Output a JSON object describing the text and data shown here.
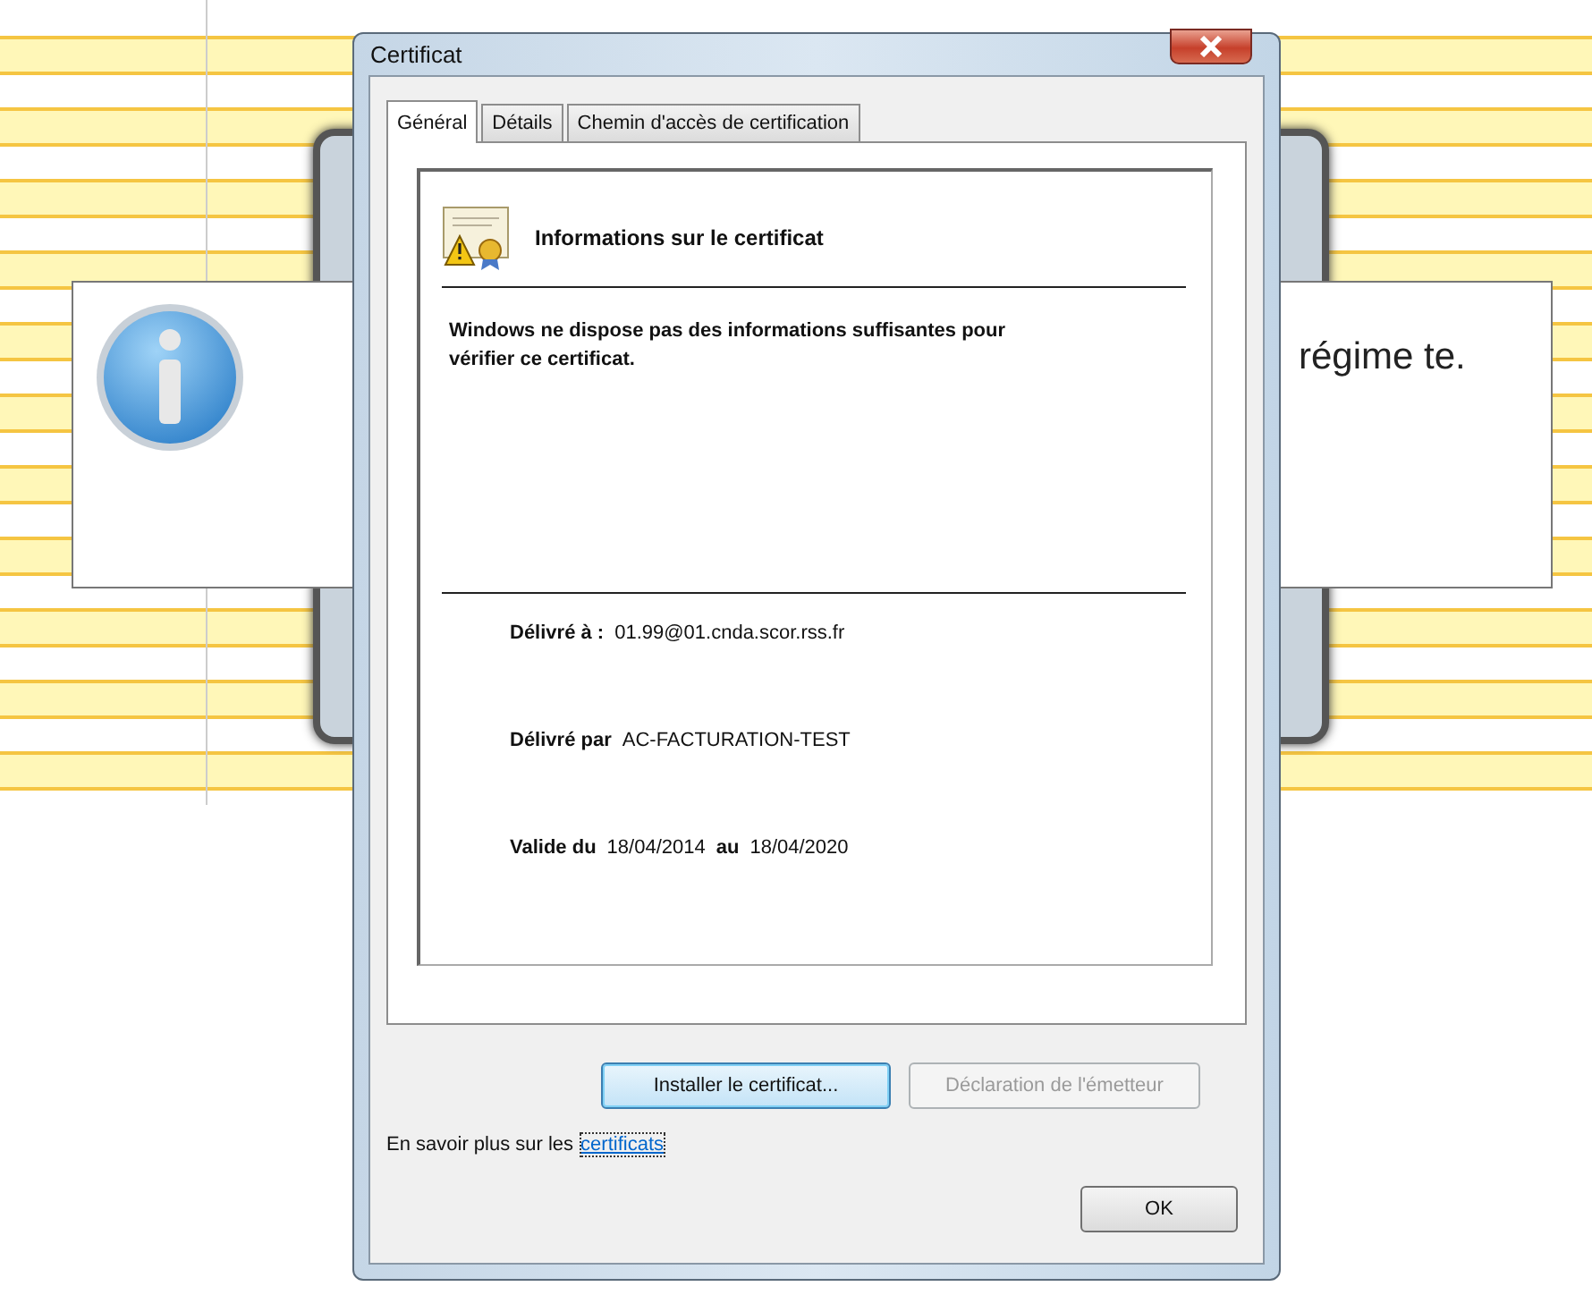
{
  "message_box": {
    "text": "régime te."
  },
  "dialog": {
    "title": "Certificat",
    "tabs": [
      {
        "label": "Général",
        "selected": true
      },
      {
        "label": "Détails",
        "selected": false
      },
      {
        "label": "Chemin d'accès de certification",
        "selected": false
      }
    ],
    "heading": "Informations sur le certificat",
    "warning": "Windows ne dispose pas des informations suffisantes pour vérifier ce certificat.",
    "fields": [
      {
        "label": "Délivré à :",
        "value": "01.99@01.cnda.scor.rss.fr"
      },
      {
        "label": "Délivré par",
        "value": "AC-FACTURATION-TEST"
      }
    ],
    "validity": {
      "label": "Valide du",
      "from": "18/04/2014",
      "to_label": "au",
      "to": "18/04/2020"
    },
    "buttons": [
      {
        "label": "Installer le certificat...",
        "disabled": false
      },
      {
        "label": "Déclaration de l'émetteur",
        "disabled": true
      }
    ],
    "learn_more": {
      "text": "En savoir plus sur les",
      "link": "certificats"
    },
    "ok_button": "OK"
  }
}
